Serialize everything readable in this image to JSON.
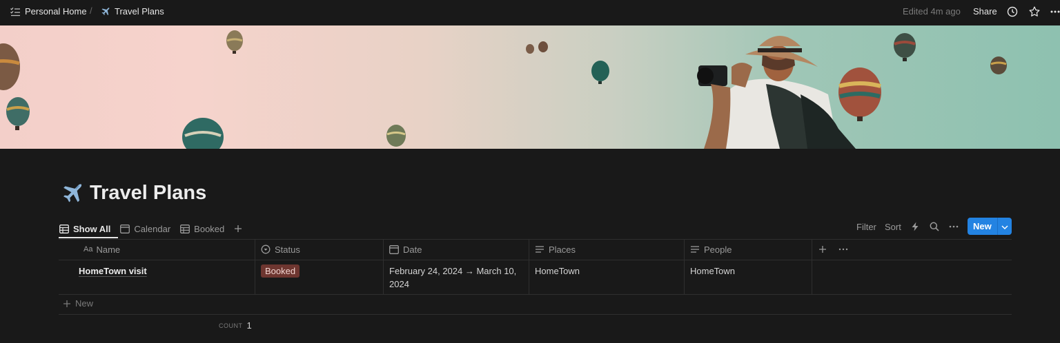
{
  "topbar": {
    "breadcrumb_root": "Personal Home",
    "breadcrumb_separator": "/",
    "breadcrumb_page": "Travel Plans",
    "edited": "Edited 4m ago",
    "share": "Share"
  },
  "page": {
    "title": "Travel Plans",
    "icon": "airplane-icon"
  },
  "views": [
    {
      "label": "Show All",
      "icon": "table-icon",
      "active": true
    },
    {
      "label": "Calendar",
      "icon": "calendar-icon",
      "active": false
    },
    {
      "label": "Booked",
      "icon": "table-icon",
      "active": false
    }
  ],
  "toolbar": {
    "filter": "Filter",
    "sort": "Sort",
    "new": "New"
  },
  "table": {
    "columns": [
      {
        "label": "Name",
        "icon": "text-type-icon"
      },
      {
        "label": "Status",
        "icon": "status-icon"
      },
      {
        "label": "Date",
        "icon": "calendar-icon"
      },
      {
        "label": "Places",
        "icon": "text-lines-icon"
      },
      {
        "label": "People",
        "icon": "text-lines-icon"
      }
    ],
    "rows": [
      {
        "name": "HomeTown visit",
        "status": "Booked",
        "date_line1": "February 24, 2024 → March 10,",
        "date_line2": "2024",
        "places": "HomeTown",
        "people": "HomeTown"
      }
    ],
    "new_row": "New",
    "count_label": "COUNT",
    "count_value": "1"
  },
  "colors": {
    "background": "#191919",
    "accent": "#2383e2",
    "status_booked_bg": "#6e3630"
  }
}
